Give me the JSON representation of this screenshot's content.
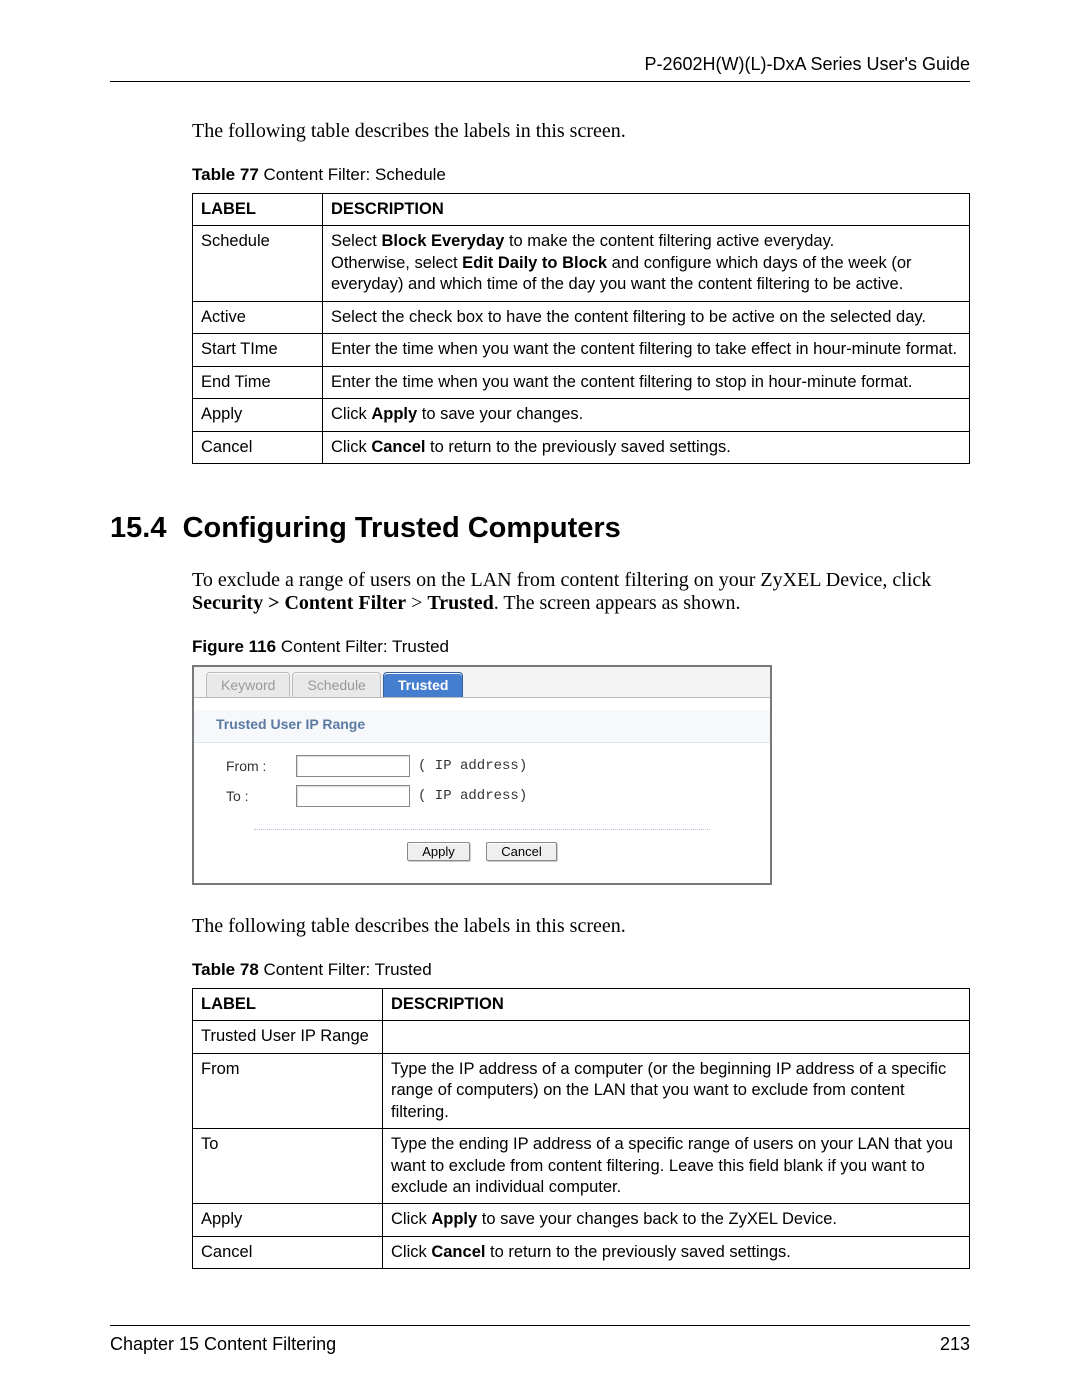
{
  "header": {
    "title": "P-2602H(W)(L)-DxA Series User's Guide"
  },
  "intro1": "The following table describes the labels in this screen.",
  "table77": {
    "caption_bold": "Table 77",
    "caption_rest": "   Content Filter: Schedule",
    "head_label": "Label",
    "head_desc": "Description",
    "rows": [
      {
        "label": "Schedule",
        "desc_parts": [
          {
            "t": "Select "
          },
          {
            "b": "Block Everyday"
          },
          {
            "t": " to make the content filtering active everyday."
          },
          {
            "br": true
          },
          {
            "t": "Otherwise, select "
          },
          {
            "b": "Edit Daily to Block"
          },
          {
            "t": " and configure which days of the week (or everyday) and which time of the day you want the content filtering to be active."
          }
        ]
      },
      {
        "label": "Active",
        "desc": "Select the check box to have the content filtering to be active on the selected day."
      },
      {
        "label": "Start TIme",
        "desc": "Enter the time when you want the content filtering to take effect in hour-minute format."
      },
      {
        "label": "End Time",
        "desc": "Enter the time when you want the content filtering to stop in hour-minute format."
      },
      {
        "label": "Apply",
        "desc_parts": [
          {
            "t": "Click "
          },
          {
            "b": "Apply"
          },
          {
            "t": " to save your changes."
          }
        ]
      },
      {
        "label": "Cancel",
        "desc_parts": [
          {
            "t": "Click "
          },
          {
            "b": "Cancel"
          },
          {
            "t": " to return to the previously saved settings."
          }
        ]
      }
    ]
  },
  "section": {
    "number": "15.4",
    "title": "Configuring Trusted Computers",
    "para_parts": [
      {
        "t": "To exclude a range of users on the LAN from content filtering on your ZyXEL Device, click "
      },
      {
        "b": "Security > Content Filter"
      },
      {
        "t": " > "
      },
      {
        "b": "Trusted"
      },
      {
        "t": ". The screen appears as shown."
      }
    ]
  },
  "figure116": {
    "caption_bold": "Figure 116",
    "caption_rest": "   Content Filter: Trusted",
    "tabs": [
      "Keyword",
      "Schedule",
      "Trusted"
    ],
    "active_tab": 2,
    "panel_title": "Trusted User IP Range",
    "from_label": "From :",
    "to_label": "To :",
    "ip_hint": "( IP address)",
    "apply": "Apply",
    "cancel": "Cancel"
  },
  "intro2": "The following table describes the labels in this screen.",
  "table78": {
    "caption_bold": "Table 78",
    "caption_rest": "   Content Filter: Trusted",
    "head_label": "Label",
    "head_desc": "Description",
    "rows": [
      {
        "label": "Trusted User IP Range",
        "desc": ""
      },
      {
        "label": "From",
        "desc": "Type the IP address of a computer (or the beginning IP address of a specific range of computers) on the LAN that you want to exclude from content filtering."
      },
      {
        "label": "To",
        "desc": "Type the ending IP address of a specific range of users on your LAN that you want to exclude from content filtering. Leave this field blank if you want to exclude an individual computer."
      },
      {
        "label": "Apply",
        "desc_parts": [
          {
            "t": "Click "
          },
          {
            "b": "Apply"
          },
          {
            "t": " to save your changes back to the ZyXEL Device."
          }
        ]
      },
      {
        "label": "Cancel",
        "desc_parts": [
          {
            "t": "Click "
          },
          {
            "b": "Cancel"
          },
          {
            "t": " to return to the previously saved settings."
          }
        ]
      }
    ]
  },
  "footer": {
    "left": "Chapter 15 Content Filtering",
    "right": "213"
  }
}
